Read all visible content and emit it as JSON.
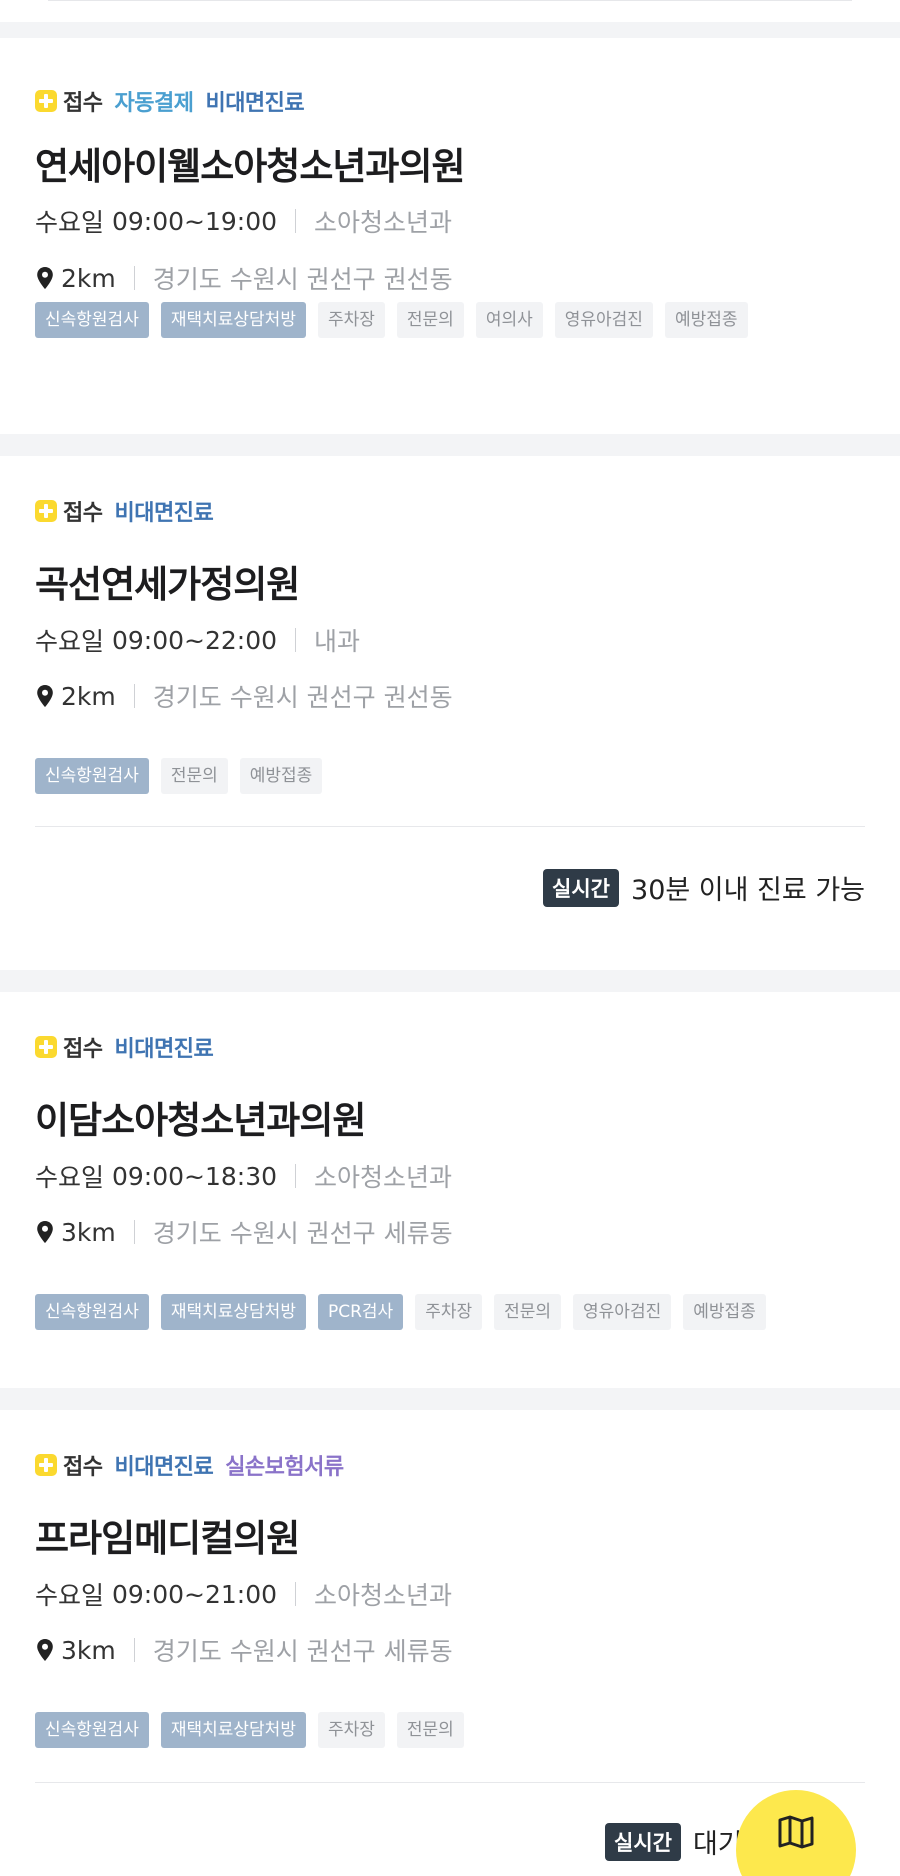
{
  "hospitals": [
    {
      "badges": [
        "접수",
        "자동결제",
        "비대면진료"
      ],
      "name": "연세아이웰소아청소년과의원",
      "day": "수요일",
      "hours": "09:00~19:00",
      "department": "소아청소년과",
      "distance": "2km",
      "address": "경기도 수원시 권선구 권선동",
      "tags_highlight": [
        "신속항원검사",
        "재택치료상담처방"
      ],
      "tags": [
        "주차장",
        "전문의",
        "여의사",
        "영유아검진",
        "예방접종"
      ]
    },
    {
      "badges": [
        "접수",
        "비대면진료"
      ],
      "name": "곡선연세가정의원",
      "day": "수요일",
      "hours": "09:00~22:00",
      "department": "내과",
      "distance": "2km",
      "address": "경기도 수원시 권선구 권선동",
      "tags_highlight": [
        "신속항원검사"
      ],
      "tags": [
        "전문의",
        "예방접종"
      ],
      "realtime_label": "실시간",
      "realtime_text": "30분 이내 진료 가능"
    },
    {
      "badges": [
        "접수",
        "비대면진료"
      ],
      "name": "이담소아청소년과의원",
      "day": "수요일",
      "hours": "09:00~18:30",
      "department": "소아청소년과",
      "distance": "3km",
      "address": "경기도 수원시 권선구 세류동",
      "tags_highlight": [
        "신속항원검사",
        "재택치료상담처방",
        "PCR검사"
      ],
      "tags": [
        "주차장",
        "전문의",
        "영유아검진",
        "예방접종"
      ]
    },
    {
      "badges": [
        "접수",
        "비대면진료",
        "실손보험서류"
      ],
      "name": "프라임메디컬의원",
      "day": "수요일",
      "hours": "09:00~21:00",
      "department": "소아청소년과",
      "distance": "3km",
      "address": "경기도 수원시 권선구 세류동",
      "tags_highlight": [
        "신속항원검사",
        "재택치료상담처방"
      ],
      "tags": [
        "주차장",
        "전문의"
      ],
      "realtime_label": "실시간",
      "realtime_text": "대기"
    }
  ],
  "map_button": {
    "icon": "map-icon"
  },
  "colors": {
    "accent_yellow": "#fbd92f",
    "remote_blue": "#3f74b2",
    "auto_blue": "#4a9fd0",
    "insurance_purple": "#8a73c9",
    "tag_highlight": "#9fb4cb"
  }
}
